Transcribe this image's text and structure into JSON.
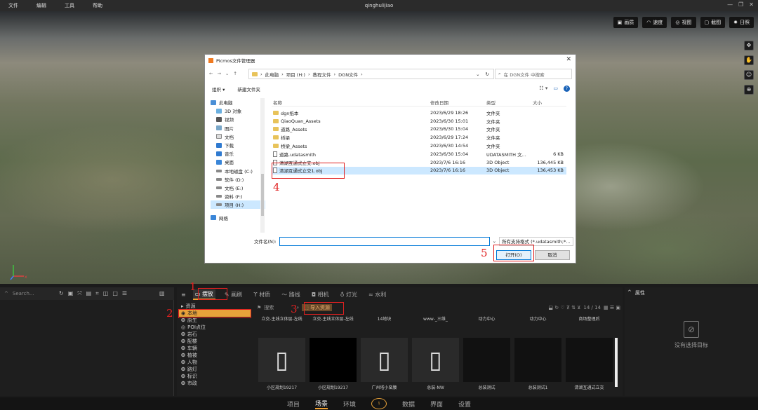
{
  "app": {
    "title": "qinghulijiao",
    "menu": [
      "文件",
      "编辑",
      "工具",
      "帮助"
    ]
  },
  "view_tools": [
    {
      "icon": "picture-icon",
      "label": "画质"
    },
    {
      "icon": "speed-icon",
      "label": "速度"
    },
    {
      "icon": "view-icon",
      "label": "视图"
    },
    {
      "icon": "screenshot-icon",
      "label": "截图"
    },
    {
      "icon": "sun-icon",
      "label": "日照"
    }
  ],
  "dialog": {
    "title": "Picmos文件管理器",
    "address": [
      "此电脑",
      "项目 (H:)",
      "教程文件",
      "DGN文件"
    ],
    "search_placeholder": "在 DGN文件 中搜索",
    "organize": "组织 ▾",
    "new_folder": "新建文件夹",
    "tree": [
      "此电脑",
      "3D 对象",
      "视频",
      "图片",
      "文档",
      "下载",
      "音乐",
      "桌面",
      "本地磁盘 (C:)",
      "软件 (D:)",
      "文档 (E:)",
      "资料 (F:)",
      "项目 (H:)",
      "网络"
    ],
    "columns": [
      "名称",
      "修改日期",
      "类型",
      "大小"
    ],
    "files": [
      {
        "name": "dgn纸本",
        "date": "2023/6/29 18:26",
        "type": "文件夹",
        "size": ""
      },
      {
        "name": "QiaoQuan_Assets",
        "date": "2023/6/30 15:01",
        "type": "文件夹",
        "size": ""
      },
      {
        "name": "道路_Assets",
        "date": "2023/6/30 15:04",
        "type": "文件夹",
        "size": ""
      },
      {
        "name": "桥梁",
        "date": "2023/6/29 17:24",
        "type": "文件夹",
        "size": ""
      },
      {
        "name": "桥梁_Assets",
        "date": "2023/6/30 14:54",
        "type": "文件夹",
        "size": ""
      },
      {
        "name": "道路.udatasmith",
        "date": "2023/6/30 15:04",
        "type": "UDATASMITH 文...",
        "size": "6 KB"
      },
      {
        "name": "清湖互通式立交.obj",
        "date": "2023/7/6 16:16",
        "type": "3D Object",
        "size": "136,445 KB"
      },
      {
        "name": "清湖互通式立交1.obj",
        "date": "2023/7/6 16:16",
        "type": "3D Object",
        "size": "136,453 KB"
      }
    ],
    "filename_label": "文件名(N):",
    "filetype": "所有支持格式 (*.udatasmith;*...",
    "open": "打开(O)",
    "cancel": "取消"
  },
  "annotations": [
    "1",
    "2",
    "3",
    "4",
    "5"
  ],
  "left_panel": {
    "search_placeholder": "Search..."
  },
  "tabs": [
    "摆放",
    "画刷",
    "材质",
    "路线",
    "相机",
    "灯光",
    "水利"
  ],
  "categories": [
    "资源",
    "本地",
    "原生",
    "POI点位",
    "岩石",
    "配楼",
    "车辆",
    "植被",
    "人物",
    "路灯",
    "标识",
    "市政"
  ],
  "asset_bar": {
    "search_placeholder": "搜索",
    "import_label": "导入资源",
    "count": "14 / 14"
  },
  "top_captions": [
    "立交-主线立体层-左线",
    "立交-主线立体层-左线",
    "14地块",
    "www-_三维_",
    "动力中心",
    "动力中心",
    "商场整理后"
  ],
  "thumbs": [
    "小区规划19217",
    "小区规划19217",
    "广州塔小蛮腰",
    "总装-NW",
    "总装测试",
    "总装测试1",
    "清湖互通式立交"
  ],
  "properties": {
    "title": "属性",
    "empty": "没有选择目标"
  },
  "bottom_nav": [
    "项目",
    "场景",
    "环境",
    "数据",
    "界面",
    "设置"
  ]
}
